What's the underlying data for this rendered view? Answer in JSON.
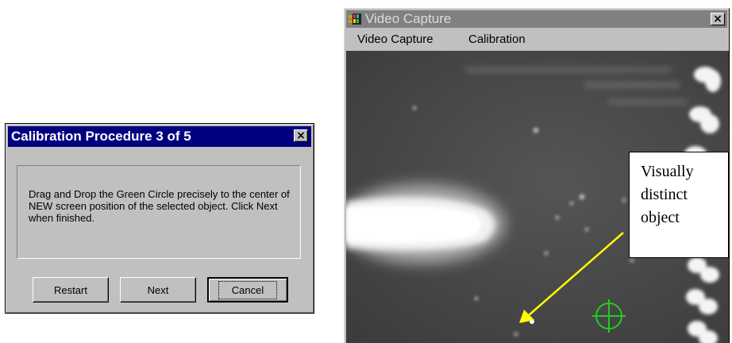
{
  "dialog": {
    "title": "Calibration Procedure 3 of 5",
    "close_label": "×",
    "message": "Drag and Drop the Green Circle precisely to the center of NEW screen position of the selected object. Click Next when finished.",
    "buttons": {
      "restart": "Restart",
      "next": "Next",
      "cancel": "Cancel"
    }
  },
  "video_window": {
    "title": "Video Capture",
    "close_label": "×",
    "menu": [
      "Video Capture",
      "Calibration"
    ],
    "target_color": "#22cc22",
    "icon": "app-icon"
  },
  "callout": {
    "lines": [
      "Visually",
      "distinct",
      "object"
    ],
    "arrow_color": "#ffff00"
  }
}
